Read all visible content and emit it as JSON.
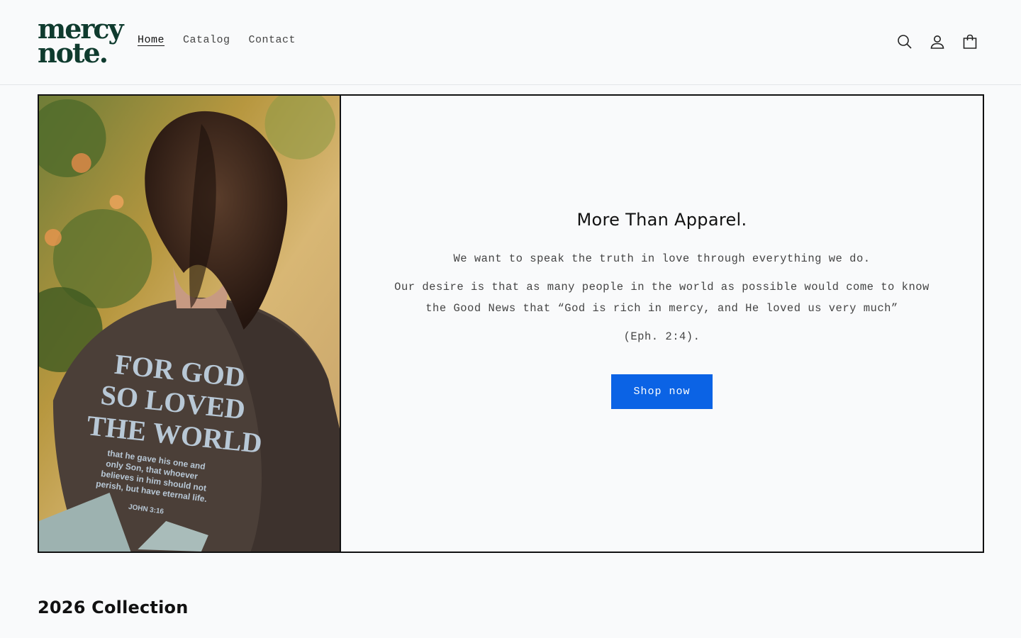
{
  "header": {
    "logo_line1": "mercy",
    "logo_line2": "note.",
    "nav": [
      {
        "label": "Home",
        "active": true
      },
      {
        "label": "Catalog",
        "active": false
      },
      {
        "label": "Contact",
        "active": false
      }
    ],
    "icons": [
      "search-icon",
      "account-icon",
      "cart-icon"
    ]
  },
  "hero": {
    "image": {
      "shirt_print_line1": "FOR GOD",
      "shirt_print_line2": "SO LOVED",
      "shirt_print_line3": "THE WORLD",
      "shirt_small_1": "that he gave his one and",
      "shirt_small_2": "only Son, that whoever",
      "shirt_small_3": "believes in him should not",
      "shirt_small_4": "perish, but have eternal life.",
      "shirt_ref": "JOHN 3:16"
    },
    "title": "More Than Apparel.",
    "paragraph1": "We want to speak the truth in love through everything we do.",
    "paragraph2": "Our desire is that as many people in the world as possible would come to know the Good News that “God is rich in mercy, and He loved us very much”",
    "paragraph3": "(Eph. 2:4).",
    "button_label": "Shop now",
    "button_color": "#0b63e5"
  },
  "collection": {
    "title": "2026 Collection"
  }
}
